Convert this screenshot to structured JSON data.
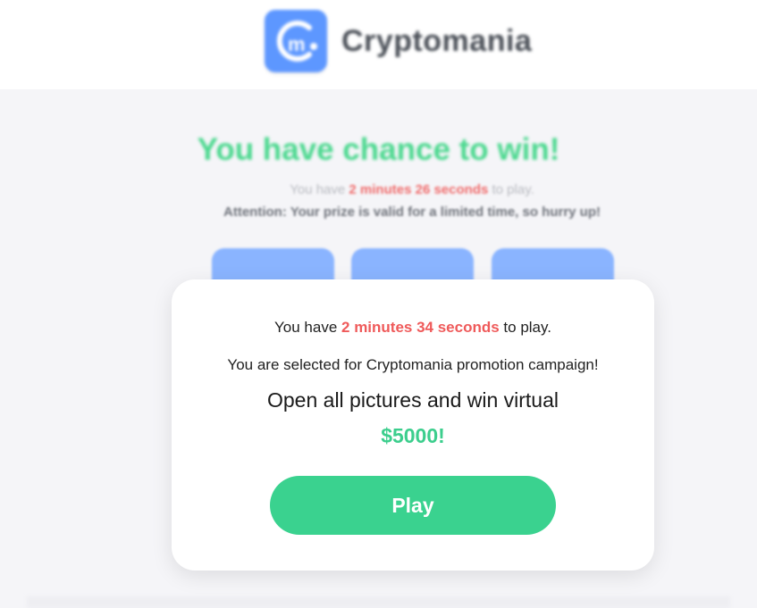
{
  "header": {
    "brand_name": "Cryptomania",
    "logo_icon": "cryptomania-logo-icon",
    "logo_letter": "m",
    "brand_color": "#5d97ff"
  },
  "background": {
    "headline": "You have chance to win!",
    "timer_prefix": "You have ",
    "timer_value": "2 minutes 26 seconds",
    "timer_suffix": " to play.",
    "attention": "Attention: Your prize is valid for a limited time, so hurry up!",
    "tile_count": 3
  },
  "modal": {
    "timer_prefix": "You have ",
    "timer_value": "2 minutes 34 seconds",
    "timer_suffix": " to play.",
    "selected_text": "You are selected for Cryptomania promotion campaign!",
    "open_text": "Open all pictures and win virtual",
    "amount": "$5000!",
    "play_label": "Play"
  },
  "colors": {
    "accent_green": "#3ad28f",
    "timer_red": "#ef5a5a",
    "tile_blue": "#8ab4ff"
  }
}
